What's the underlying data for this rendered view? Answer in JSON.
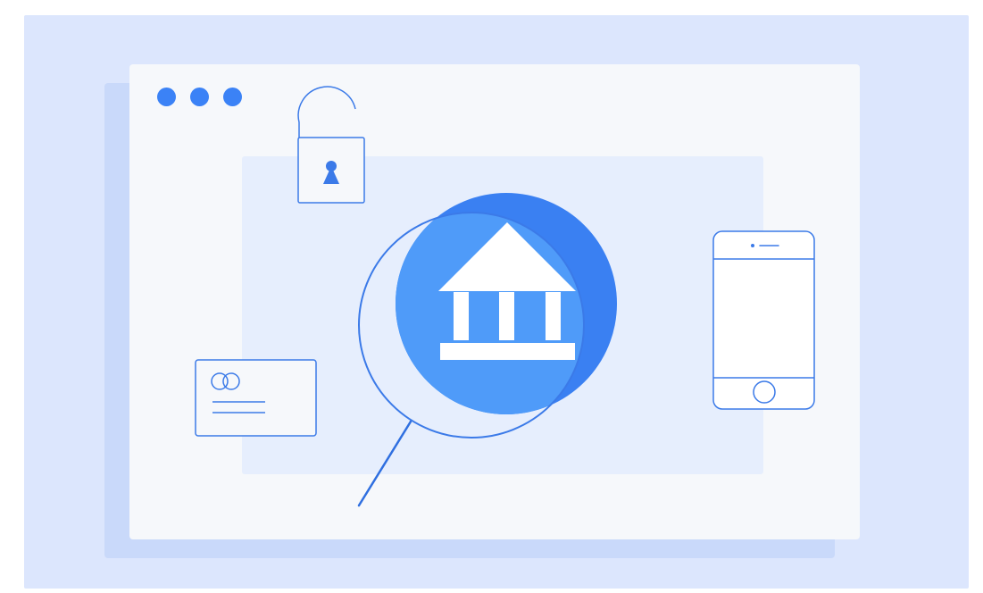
{
  "illustration": {
    "topic": "online-banking-security",
    "icons": [
      "lock-icon",
      "bank-icon",
      "magnifier-icon",
      "credit-card-icon",
      "smartphone-icon",
      "browser-window-icon"
    ]
  },
  "colors": {
    "stage_background": "#dce6fd",
    "window_shadow": "#c9d9fa",
    "window": "#f6f8fb",
    "panel": "#e6eefd",
    "dot": "#3b82f6",
    "stroke": "#3b7ae8",
    "circle_dark": "#3a80f2",
    "circle_light": "#4f9bf9",
    "white": "#ffffff"
  }
}
